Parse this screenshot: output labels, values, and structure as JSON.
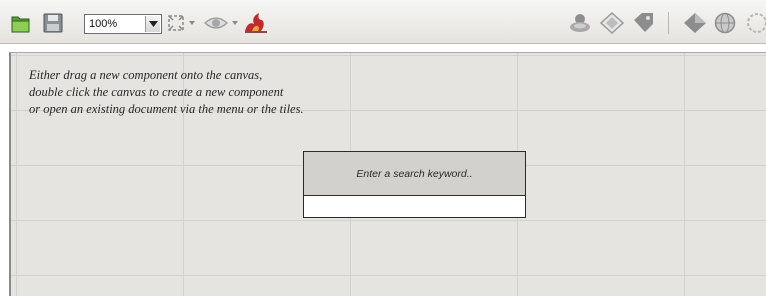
{
  "toolbar": {
    "zoom": {
      "value": "100%"
    },
    "icons": {
      "open": "folder-open-icon",
      "save": "floppy-disk-icon",
      "zoom_dropdown": "chevron-down-icon",
      "fit": "fit-to-screen-icon",
      "preview": "eye-icon",
      "tool": "flame-brush-icon",
      "right_group": [
        "layers-icon",
        "rotate-diamond-icon",
        "tag-icon",
        "shape-diamond-icon",
        "globe-icon",
        "circle-icon"
      ]
    }
  },
  "canvas": {
    "hint_lines": [
      "Either drag a new component onto the canvas,",
      "double click the canvas to create a new component",
      "or open an existing document via the menu or the tiles."
    ],
    "search": {
      "prompt": "Enter a search keyword..",
      "value": ""
    }
  }
}
